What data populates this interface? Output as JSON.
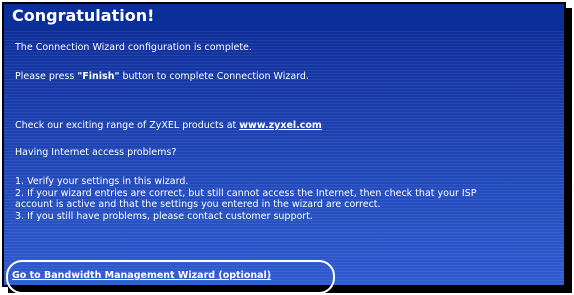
{
  "dialog": {
    "title": "Congratulation!",
    "line_complete": "The Connection Wizard configuration is complete.",
    "press_prefix": "Please press ",
    "press_button": "\"Finish\"",
    "press_suffix": " button to complete Connection Wizard.",
    "check_prefix": "Check our exciting range of ZyXEL products at ",
    "check_link": "www.zyxel.com",
    "problems_heading": "Having Internet access problems?",
    "tips": [
      "1. Verify your settings in this wizard.",
      "2. If your wizard entries are correct, but still cannot access the Internet, then check that your ISP",
      "account is active and that the settings you entered in the wizard are correct.",
      "3. If you still have problems, please contact customer support."
    ],
    "bandwidth_link": "Go to Bandwidth Management Wizard (optional)"
  },
  "colors": {
    "panel_top": "#0b2a94",
    "panel_bottom": "#2f5bd0",
    "text": "#ffffff",
    "highlight": "#ffffff"
  }
}
